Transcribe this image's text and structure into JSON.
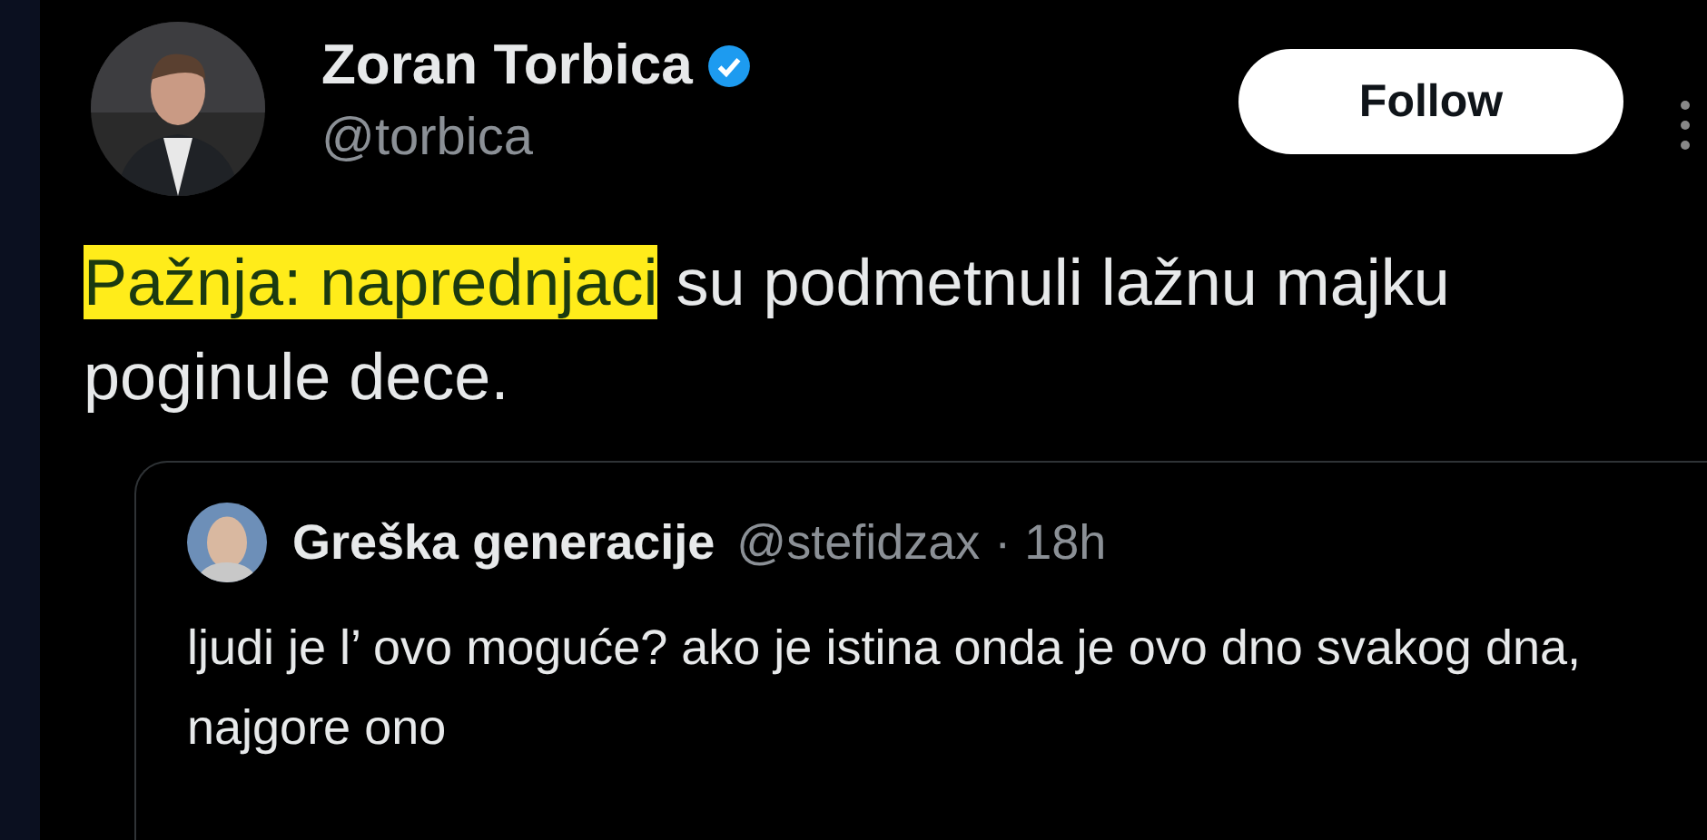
{
  "author": {
    "name": "Zoran Torbica",
    "verified": true,
    "handle": "@torbica"
  },
  "follow_button": {
    "label": "Follow"
  },
  "tweet_text": [
    {
      "text": "Pažnja: naprednjaci",
      "highlighted": true
    },
    {
      "text": " su podmetnuli lažnu majku poginule dece.",
      "highlighted": false
    }
  ],
  "quoted_tweet": {
    "name": "Greška generacije",
    "handle": "@stefidzax",
    "time": "· 18h",
    "text": "ljudi je l’ ovo moguće? ako je istina onda je ovo dno svakog dna, najgore ono"
  }
}
